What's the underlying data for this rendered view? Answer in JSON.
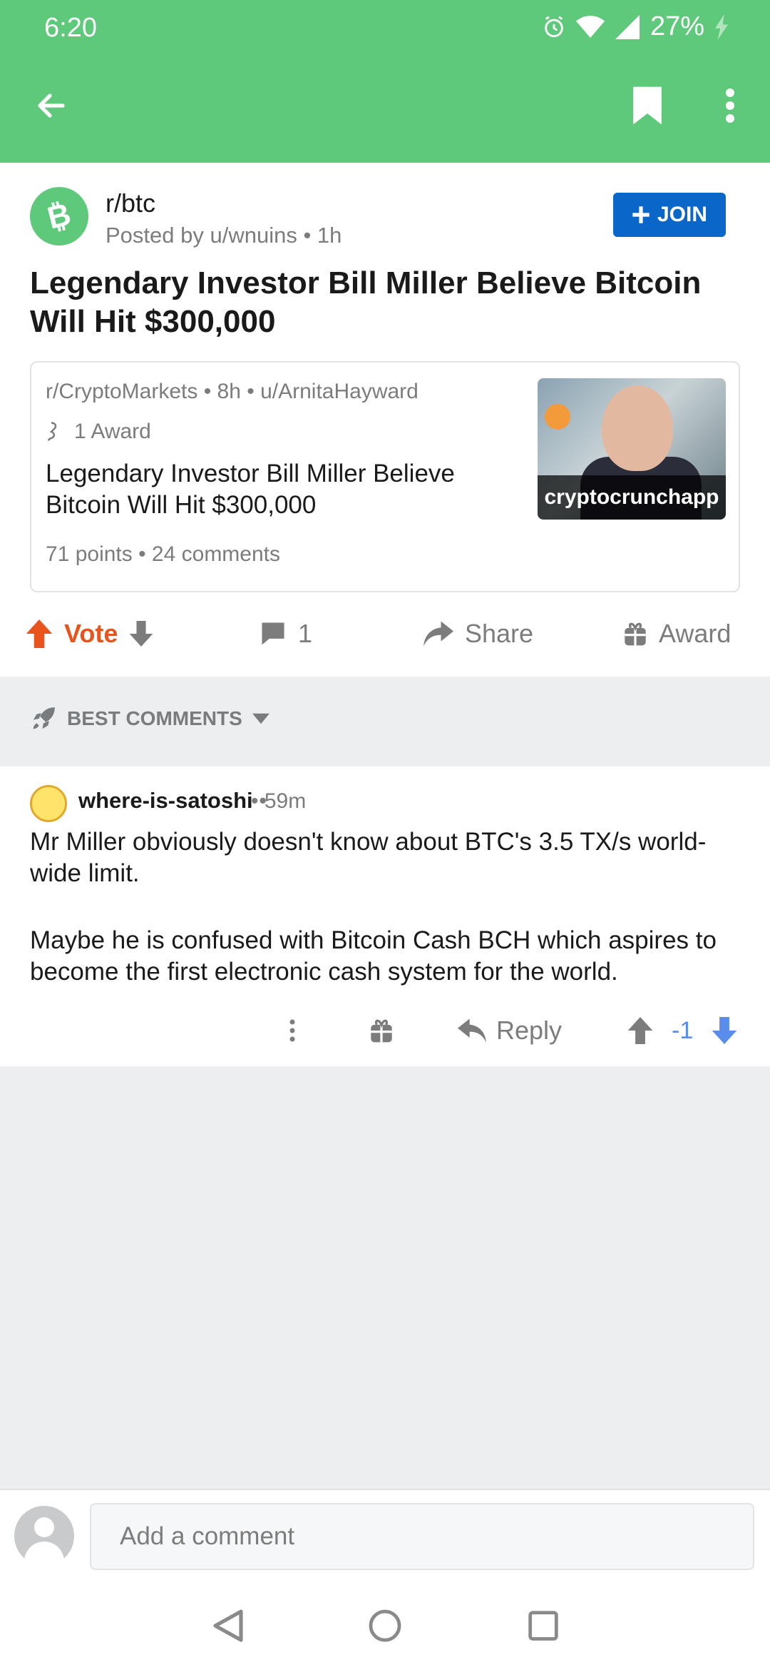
{
  "status": {
    "time": "6:20",
    "battery": "27%"
  },
  "appbar": {
    "back_icon": "arrow-left-icon",
    "bookmark_icon": "bookmark-icon",
    "more_icon": "more-vertical-icon"
  },
  "post": {
    "subreddit": "r/btc",
    "posted_by": "Posted by u/wnuins • 1h",
    "join_label": "JOIN",
    "title": "Legendary Investor Bill Miller Believe Bitcoin Will Hit $300,000",
    "crosspost": {
      "meta": "r/CryptoMarkets • 8h • u/ArnitaHayward",
      "award": "1 Award",
      "title": "Legendary Investor Bill Miller Believe Bitcoin Will Hit $300,000",
      "stats": "71 points • 24 comments",
      "thumbnail_caption": "cryptocrunchapp"
    },
    "actions": {
      "vote": "Vote",
      "comments": "1",
      "share": "Share",
      "award": "Award"
    }
  },
  "sort": {
    "label": "BEST COMMENTS"
  },
  "comment": {
    "author": "where-is-satoshi",
    "separator": "•",
    "time": "• 59m",
    "body": [
      "Mr Miller obviously doesn't know about BTC's 3.5 TX/s world-wide limit.",
      "Maybe he is confused with Bitcoin Cash BCH which aspires to become the first electronic cash system for the world."
    ],
    "reply": "Reply",
    "score": "-1"
  },
  "composer": {
    "placeholder": "Add a comment"
  },
  "colors": {
    "header": "#5ec97a",
    "join": "#0a66c9",
    "upvote": "#e8541b",
    "downvote": "#5a8cec"
  }
}
